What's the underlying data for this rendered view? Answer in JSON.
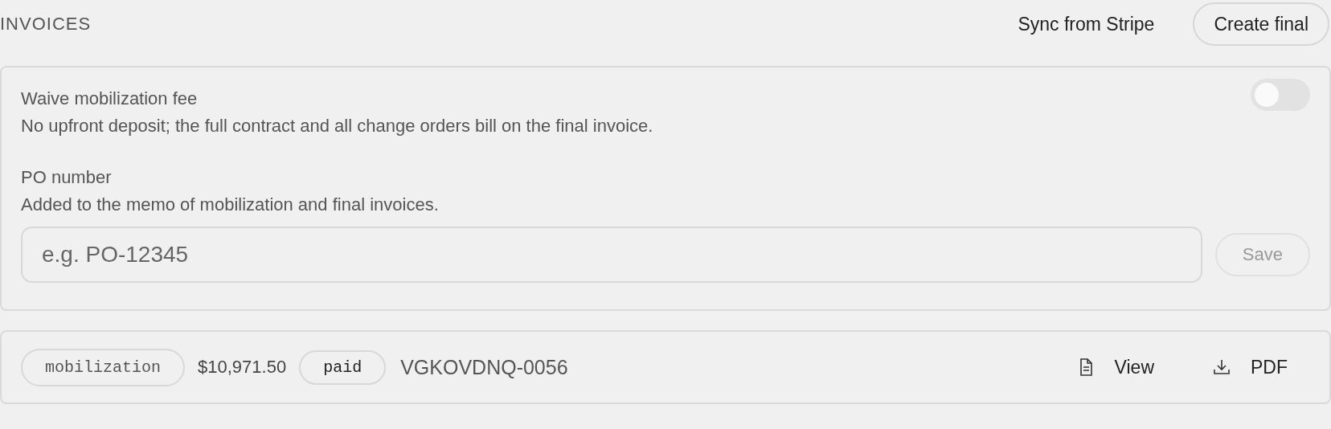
{
  "header": {
    "title": "INVOICES",
    "actions": [
      {
        "label": "Sync from Stripe",
        "kind": "plain"
      },
      {
        "label": "Create final",
        "kind": "outlined"
      }
    ]
  },
  "settings": {
    "waive": {
      "label": "Waive mobilization fee",
      "description": "No upfront deposit; the full contract and all change orders bill on the final invoice.",
      "on": false
    },
    "po": {
      "label": "PO number",
      "description": "Added to the memo of mobilization and final invoices.",
      "placeholder": "e.g. PO-12345",
      "save": {
        "label": "Save",
        "disabled": true
      }
    }
  },
  "invoices": [
    {
      "type": "mobilization",
      "amount": "$10,971.50",
      "status": "paid",
      "number": "VGKOVDNQ-0056",
      "actions": [
        {
          "label": "View",
          "kind": "view"
        },
        {
          "label": "PDF",
          "kind": "pdf"
        }
      ]
    }
  ]
}
